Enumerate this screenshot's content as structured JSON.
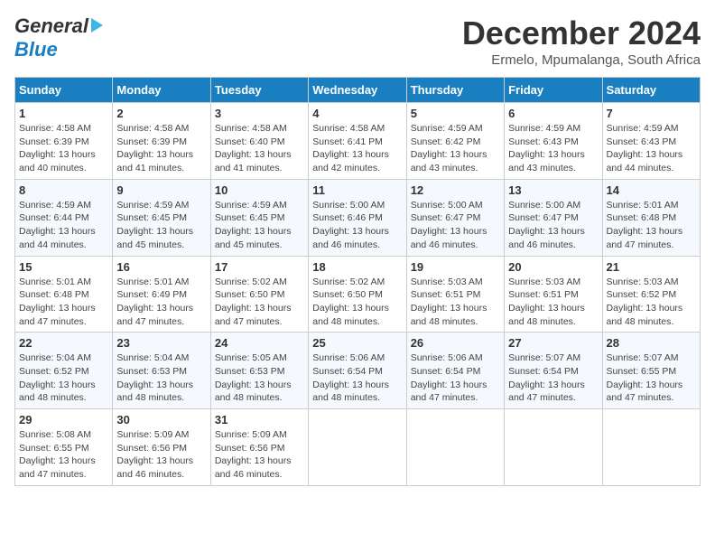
{
  "logo": {
    "general": "General",
    "blue": "Blue"
  },
  "title": "December 2024",
  "subtitle": "Ermelo, Mpumalanga, South Africa",
  "days_of_week": [
    "Sunday",
    "Monday",
    "Tuesday",
    "Wednesday",
    "Thursday",
    "Friday",
    "Saturday"
  ],
  "weeks": [
    [
      {
        "day": "1",
        "sunrise": "Sunrise: 4:58 AM",
        "sunset": "Sunset: 6:39 PM",
        "daylight": "Daylight: 13 hours and 40 minutes."
      },
      {
        "day": "2",
        "sunrise": "Sunrise: 4:58 AM",
        "sunset": "Sunset: 6:39 PM",
        "daylight": "Daylight: 13 hours and 41 minutes."
      },
      {
        "day": "3",
        "sunrise": "Sunrise: 4:58 AM",
        "sunset": "Sunset: 6:40 PM",
        "daylight": "Daylight: 13 hours and 41 minutes."
      },
      {
        "day": "4",
        "sunrise": "Sunrise: 4:58 AM",
        "sunset": "Sunset: 6:41 PM",
        "daylight": "Daylight: 13 hours and 42 minutes."
      },
      {
        "day": "5",
        "sunrise": "Sunrise: 4:59 AM",
        "sunset": "Sunset: 6:42 PM",
        "daylight": "Daylight: 13 hours and 43 minutes."
      },
      {
        "day": "6",
        "sunrise": "Sunrise: 4:59 AM",
        "sunset": "Sunset: 6:43 PM",
        "daylight": "Daylight: 13 hours and 43 minutes."
      },
      {
        "day": "7",
        "sunrise": "Sunrise: 4:59 AM",
        "sunset": "Sunset: 6:43 PM",
        "daylight": "Daylight: 13 hours and 44 minutes."
      }
    ],
    [
      {
        "day": "8",
        "sunrise": "Sunrise: 4:59 AM",
        "sunset": "Sunset: 6:44 PM",
        "daylight": "Daylight: 13 hours and 44 minutes."
      },
      {
        "day": "9",
        "sunrise": "Sunrise: 4:59 AM",
        "sunset": "Sunset: 6:45 PM",
        "daylight": "Daylight: 13 hours and 45 minutes."
      },
      {
        "day": "10",
        "sunrise": "Sunrise: 4:59 AM",
        "sunset": "Sunset: 6:45 PM",
        "daylight": "Daylight: 13 hours and 45 minutes."
      },
      {
        "day": "11",
        "sunrise": "Sunrise: 5:00 AM",
        "sunset": "Sunset: 6:46 PM",
        "daylight": "Daylight: 13 hours and 46 minutes."
      },
      {
        "day": "12",
        "sunrise": "Sunrise: 5:00 AM",
        "sunset": "Sunset: 6:47 PM",
        "daylight": "Daylight: 13 hours and 46 minutes."
      },
      {
        "day": "13",
        "sunrise": "Sunrise: 5:00 AM",
        "sunset": "Sunset: 6:47 PM",
        "daylight": "Daylight: 13 hours and 46 minutes."
      },
      {
        "day": "14",
        "sunrise": "Sunrise: 5:01 AM",
        "sunset": "Sunset: 6:48 PM",
        "daylight": "Daylight: 13 hours and 47 minutes."
      }
    ],
    [
      {
        "day": "15",
        "sunrise": "Sunrise: 5:01 AM",
        "sunset": "Sunset: 6:48 PM",
        "daylight": "Daylight: 13 hours and 47 minutes."
      },
      {
        "day": "16",
        "sunrise": "Sunrise: 5:01 AM",
        "sunset": "Sunset: 6:49 PM",
        "daylight": "Daylight: 13 hours and 47 minutes."
      },
      {
        "day": "17",
        "sunrise": "Sunrise: 5:02 AM",
        "sunset": "Sunset: 6:50 PM",
        "daylight": "Daylight: 13 hours and 47 minutes."
      },
      {
        "day": "18",
        "sunrise": "Sunrise: 5:02 AM",
        "sunset": "Sunset: 6:50 PM",
        "daylight": "Daylight: 13 hours and 48 minutes."
      },
      {
        "day": "19",
        "sunrise": "Sunrise: 5:03 AM",
        "sunset": "Sunset: 6:51 PM",
        "daylight": "Daylight: 13 hours and 48 minutes."
      },
      {
        "day": "20",
        "sunrise": "Sunrise: 5:03 AM",
        "sunset": "Sunset: 6:51 PM",
        "daylight": "Daylight: 13 hours and 48 minutes."
      },
      {
        "day": "21",
        "sunrise": "Sunrise: 5:03 AM",
        "sunset": "Sunset: 6:52 PM",
        "daylight": "Daylight: 13 hours and 48 minutes."
      }
    ],
    [
      {
        "day": "22",
        "sunrise": "Sunrise: 5:04 AM",
        "sunset": "Sunset: 6:52 PM",
        "daylight": "Daylight: 13 hours and 48 minutes."
      },
      {
        "day": "23",
        "sunrise": "Sunrise: 5:04 AM",
        "sunset": "Sunset: 6:53 PM",
        "daylight": "Daylight: 13 hours and 48 minutes."
      },
      {
        "day": "24",
        "sunrise": "Sunrise: 5:05 AM",
        "sunset": "Sunset: 6:53 PM",
        "daylight": "Daylight: 13 hours and 48 minutes."
      },
      {
        "day": "25",
        "sunrise": "Sunrise: 5:06 AM",
        "sunset": "Sunset: 6:54 PM",
        "daylight": "Daylight: 13 hours and 48 minutes."
      },
      {
        "day": "26",
        "sunrise": "Sunrise: 5:06 AM",
        "sunset": "Sunset: 6:54 PM",
        "daylight": "Daylight: 13 hours and 47 minutes."
      },
      {
        "day": "27",
        "sunrise": "Sunrise: 5:07 AM",
        "sunset": "Sunset: 6:54 PM",
        "daylight": "Daylight: 13 hours and 47 minutes."
      },
      {
        "day": "28",
        "sunrise": "Sunrise: 5:07 AM",
        "sunset": "Sunset: 6:55 PM",
        "daylight": "Daylight: 13 hours and 47 minutes."
      }
    ],
    [
      {
        "day": "29",
        "sunrise": "Sunrise: 5:08 AM",
        "sunset": "Sunset: 6:55 PM",
        "daylight": "Daylight: 13 hours and 47 minutes."
      },
      {
        "day": "30",
        "sunrise": "Sunrise: 5:09 AM",
        "sunset": "Sunset: 6:56 PM",
        "daylight": "Daylight: 13 hours and 46 minutes."
      },
      {
        "day": "31",
        "sunrise": "Sunrise: 5:09 AM",
        "sunset": "Sunset: 6:56 PM",
        "daylight": "Daylight: 13 hours and 46 minutes."
      },
      null,
      null,
      null,
      null
    ]
  ]
}
